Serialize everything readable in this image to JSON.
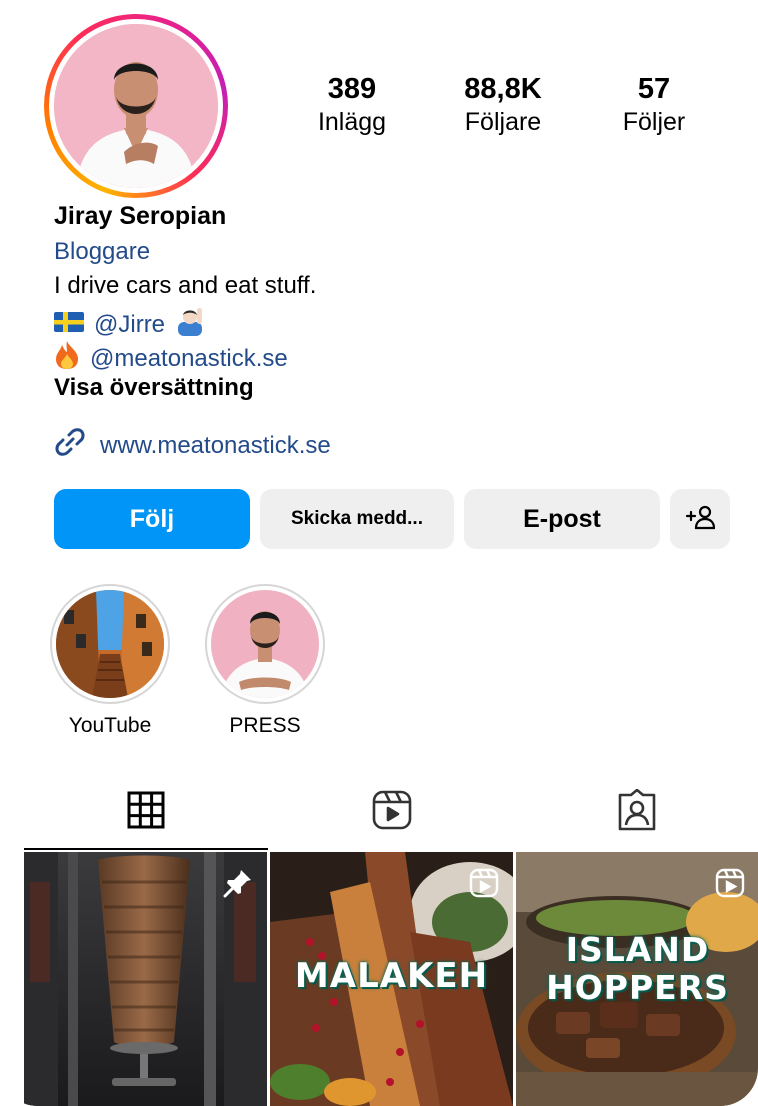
{
  "profile": {
    "name": "Jiray Seropian",
    "category": "Bloggare",
    "bio": "I drive cars and eat stuff.",
    "mention_1": "@Jirre",
    "mention_2": "@meatonastick.se",
    "translate_label": "Visa översättning",
    "website": "www.meatonastick.se"
  },
  "stats": [
    {
      "value": "389",
      "label": "Inlägg"
    },
    {
      "value": "88,8K",
      "label": "Följare"
    },
    {
      "value": "57",
      "label": "Följer"
    }
  ],
  "buttons": {
    "follow": "Följ",
    "message": "Skicka medd...",
    "email": "E-post"
  },
  "highlights": [
    {
      "label": "YouTube"
    },
    {
      "label": "PRESS"
    }
  ],
  "posts": [
    {
      "overlay": "",
      "icon": "pin-icon"
    },
    {
      "overlay": "MALAKEH",
      "icon": "reels-icon"
    },
    {
      "overlay_line1": "ISLAND",
      "overlay_line2": "HOPPERS",
      "icon": "reels-icon"
    }
  ],
  "colors": {
    "follow_button": "#0095f6",
    "secondary_button": "#efefef",
    "link": "#234b8a"
  }
}
